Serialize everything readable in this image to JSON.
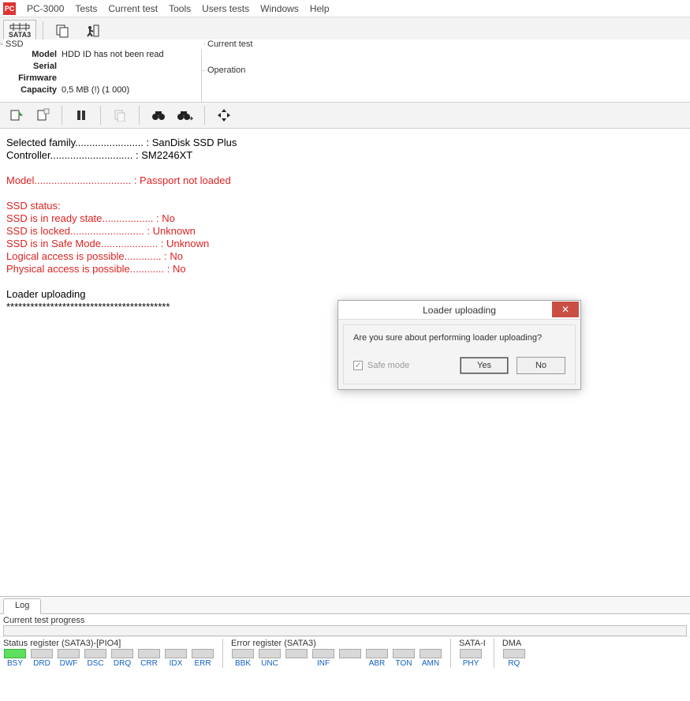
{
  "app": {
    "title": "PC-3000"
  },
  "menu": {
    "items": [
      "Tests",
      "Current test",
      "Tools",
      "Users tests",
      "Windows",
      "Help"
    ]
  },
  "toolbar1": {
    "port_label": "SATA3"
  },
  "ssd": {
    "legend": "SSD",
    "rows": [
      {
        "label": "Model",
        "value": "HDD ID has not been read"
      },
      {
        "label": "Serial",
        "value": ""
      },
      {
        "label": "Firmware",
        "value": ""
      },
      {
        "label": "Capacity",
        "value": "0,5 MB (!) (1 000)"
      }
    ]
  },
  "right_panels": {
    "current_test": "Current test",
    "operation": "Operation"
  },
  "console_lines": [
    {
      "t": "Selected family........................ : SanDisk SSD Plus",
      "c": "blk"
    },
    {
      "t": "Controller............................. : SM2246XT",
      "c": "blk"
    },
    {
      "t": "",
      "c": "blk"
    },
    {
      "t": "Model.................................. : Passport not loaded",
      "c": "red"
    },
    {
      "t": "",
      "c": "blk"
    },
    {
      "t": "SSD status:",
      "c": "red"
    },
    {
      "t": "SSD is in ready state.................. : No",
      "c": "red"
    },
    {
      "t": "SSD is locked.......................... : Unknown",
      "c": "red"
    },
    {
      "t": "SSD is in Safe Mode.................... : Unknown",
      "c": "red"
    },
    {
      "t": "Logical access is possible............. : No",
      "c": "red"
    },
    {
      "t": "Physical access is possible............ : No",
      "c": "red"
    },
    {
      "t": "",
      "c": "blk"
    },
    {
      "t": "Loader uploading",
      "c": "blk"
    },
    {
      "t": "*****************************************",
      "c": "blk"
    }
  ],
  "tab": {
    "log": "Log"
  },
  "progress": {
    "label": "Current test progress"
  },
  "status_register": {
    "title": "Status register (SATA3)-[PIO4]",
    "items": [
      {
        "name": "BSY",
        "on": true
      },
      {
        "name": "DRD",
        "on": false
      },
      {
        "name": "DWF",
        "on": false
      },
      {
        "name": "DSC",
        "on": false
      },
      {
        "name": "DRQ",
        "on": false
      },
      {
        "name": "CRR",
        "on": false
      },
      {
        "name": "IDX",
        "on": false
      },
      {
        "name": "ERR",
        "on": false
      }
    ]
  },
  "error_register": {
    "title": "Error register (SATA3)",
    "items": [
      {
        "name": "BBK"
      },
      {
        "name": "UNC"
      },
      {
        "name": ""
      },
      {
        "name": "INF"
      },
      {
        "name": ""
      },
      {
        "name": "ABR"
      },
      {
        "name": "TON"
      },
      {
        "name": "AMN"
      }
    ]
  },
  "sata_i": {
    "title": "SATA-I",
    "items": [
      {
        "name": "PHY"
      }
    ]
  },
  "dma": {
    "title": "DMA",
    "items": [
      {
        "name": "RQ"
      }
    ]
  },
  "dialog": {
    "title": "Loader uploading",
    "message": "Are you sure about performing loader uploading?",
    "safe_mode": "Safe mode",
    "yes": "Yes",
    "no": "No"
  }
}
